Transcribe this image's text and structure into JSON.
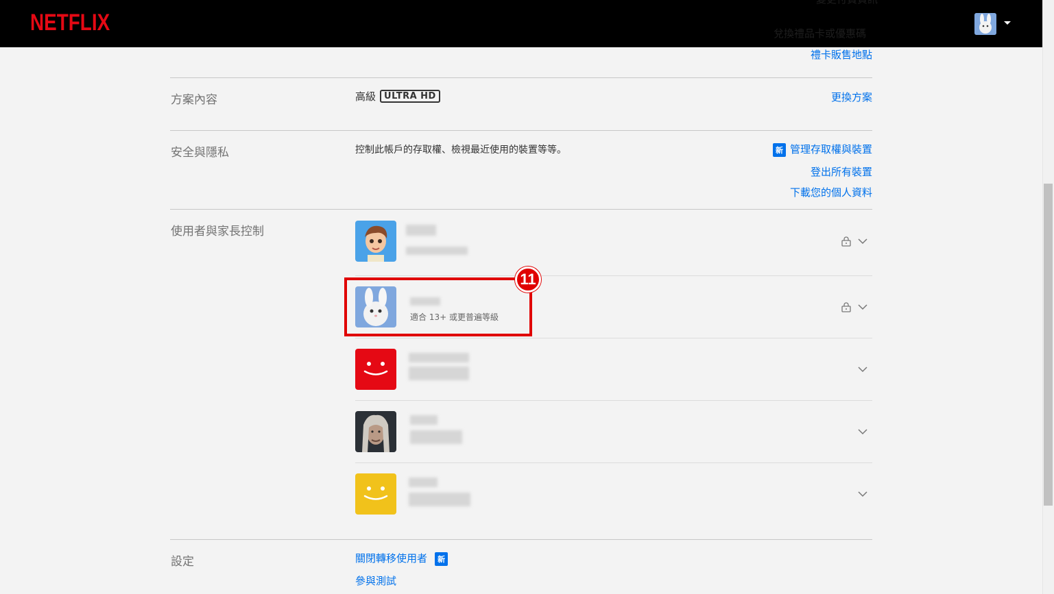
{
  "header": {
    "logo": "NETFLIX",
    "ghost_links": [
      "變更付費資訊",
      "兌換禮品卡或優惠碼"
    ]
  },
  "top_links": {
    "gift_card_stores": "禮卡販售地點"
  },
  "plan": {
    "label": "方案內容",
    "tier": "高級",
    "badge": "ULTRA HD",
    "change_link": "更換方案"
  },
  "security": {
    "label": "安全與隱私",
    "description": "控制此帳戶的存取權、檢視最近使用的裝置等等。",
    "new_badge": "新",
    "manage_link": "管理存取權與裝置",
    "signout_link": "登出所有裝置",
    "download_link": "下載您的個人資料"
  },
  "profiles": {
    "label": "使用者與家長控制",
    "items": [
      {
        "avatar": "cartoon-boy",
        "subtitle": "",
        "locked": true
      },
      {
        "avatar": "white-bunny",
        "subtitle": "適合 13+ 或更普遍等級",
        "locked": true
      },
      {
        "avatar": "red-smiley",
        "subtitle": "",
        "locked": false
      },
      {
        "avatar": "witcher-portrait",
        "subtitle": "",
        "locked": false
      },
      {
        "avatar": "yellow-smiley",
        "subtitle": "",
        "locked": false
      }
    ]
  },
  "annotation": {
    "step_number": "11",
    "color": "#e00000"
  },
  "settings": {
    "label": "設定",
    "transfer_link": "關閉轉移使用者",
    "new_badge": "新",
    "test_link": "參與測試"
  },
  "colors": {
    "brand": "#e50914",
    "link": "#0071eb"
  }
}
